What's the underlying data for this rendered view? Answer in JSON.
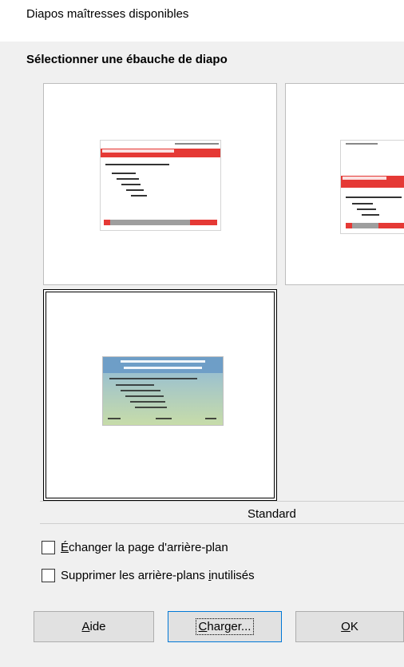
{
  "dialog": {
    "title": "Diapos maîtresses disponibles",
    "section_title": "Sélectionner une ébauche de diapo"
  },
  "slide_list": {
    "selected_caption": "Standard",
    "items": [
      {
        "theme": "red-header",
        "selected": false
      },
      {
        "theme": "red-header-partial",
        "selected": false
      },
      {
        "theme": "blue-green-gradient",
        "selected": true
      }
    ]
  },
  "options": {
    "exchange_background": {
      "label_prefix": "",
      "mnemonic": "É",
      "label_rest": "changer la page d'arrière-plan",
      "checked": false
    },
    "delete_unused": {
      "label_prefix": "Supprimer les arrière-plans ",
      "mnemonic": "i",
      "label_rest": "nutilisés",
      "checked": false
    }
  },
  "buttons": {
    "help": {
      "mnemonic": "A",
      "rest": "ide"
    },
    "load": {
      "mnemonic": "C",
      "rest": "harger..."
    },
    "ok": {
      "mnemonic": "O",
      "rest": "K"
    }
  }
}
